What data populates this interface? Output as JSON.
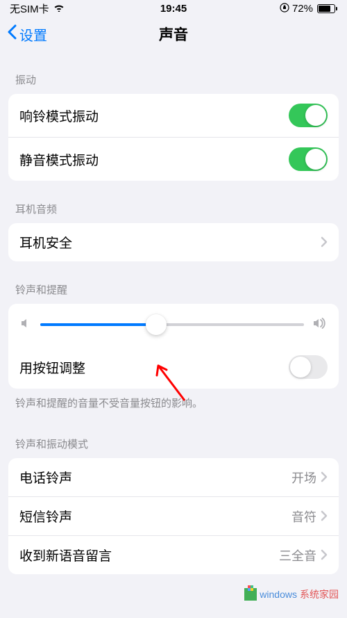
{
  "status": {
    "carrier": "无SIM卡",
    "time": "19:45",
    "battery_pct": "72%",
    "battery_level": 72
  },
  "nav": {
    "back_label": "设置",
    "title": "声音"
  },
  "sections": {
    "vibration": {
      "header": "振动",
      "ring_vibrate": {
        "label": "响铃模式振动",
        "on": true
      },
      "silent_vibrate": {
        "label": "静音模式振动",
        "on": true
      }
    },
    "headphone": {
      "header": "耳机音频",
      "safety": {
        "label": "耳机安全"
      }
    },
    "ringer": {
      "header": "铃声和提醒",
      "volume_pct": 44,
      "change_with_buttons": {
        "label": "用按钮调整",
        "on": false
      },
      "footer": "铃声和提醒的音量不受音量按钮的影响。"
    },
    "sounds": {
      "header": "铃声和振动模式",
      "ringtone": {
        "label": "电话铃声",
        "value": "开场"
      },
      "text_tone": {
        "label": "短信铃声",
        "value": "音符"
      },
      "voicemail": {
        "label": "收到新语音留言",
        "value": "三全音"
      }
    }
  },
  "watermark": {
    "text1": "windows",
    "text2": "系统家园",
    "url_hint": "www.ruihaifu.com"
  }
}
